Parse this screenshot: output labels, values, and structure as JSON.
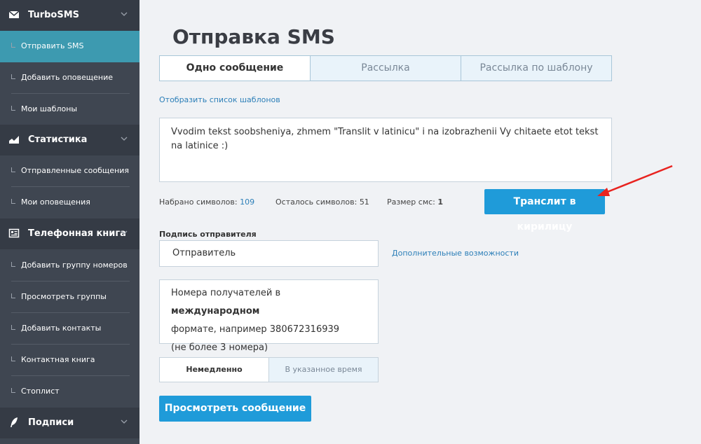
{
  "sidebar": {
    "sections": [
      {
        "title": "TurboSMS",
        "icon": "envelope-icon"
      },
      {
        "title": "Статистика",
        "icon": "chart-icon"
      },
      {
        "title": "Телефонная книга",
        "icon": "phonebook-icon"
      },
      {
        "title": "Подписи",
        "icon": "feather-icon"
      }
    ],
    "items": [
      {
        "label": "Отправить SMS",
        "active": true
      },
      {
        "label": "Добавить оповещение"
      },
      {
        "label": "Мои шаблоны"
      },
      {
        "label": "Отправленные сообщения"
      },
      {
        "label": "Мои оповещения"
      },
      {
        "label": "Добавить группу номеров"
      },
      {
        "label": "Просмотреть группы"
      },
      {
        "label": "Добавить контакты"
      },
      {
        "label": "Контактная книга"
      },
      {
        "label": "Стоплист"
      }
    ]
  },
  "main": {
    "title": "Отправка SMS",
    "tabs": [
      {
        "label": "Одно сообщение",
        "active": true
      },
      {
        "label": "Рассылка"
      },
      {
        "label": "Рассылка по шаблону"
      }
    ],
    "show_templates_link": "Отобразить список шаблонов",
    "message_text": "Vvodim tekst soobsheniya, zhmem \"Translit v latinicu\" i na izobrazhenii Vy chitaete etot tekst na latinice :)",
    "stats": {
      "typed_label": "Набрано символов:",
      "typed_value": "109",
      "remaining_label": "Осталось символов:",
      "remaining_value": "51",
      "size_label": "Размер смс:",
      "size_value": "1"
    },
    "translit_button": "Транслит в кирилицу",
    "sender_label": "Подпись отправителя",
    "sender_value": "Отправитель",
    "extra_options_link": "Дополнительные возможности",
    "recipients": {
      "text_before": "Номера получателей в ",
      "text_bold": "международном",
      "text_line2": "формате, например 380672316939",
      "text_line3": "(не более 3 номера)"
    },
    "timing": {
      "immediate": "Немедленно",
      "scheduled": "В указанное время"
    },
    "preview_button": "Просмотреть сообщение"
  },
  "colors": {
    "sidebar_bg": "#3f4651",
    "sidebar_header_bg": "#353b45",
    "active_item_bg": "#3d9ab0",
    "primary_button": "#1f9bd9",
    "link": "#2c7fb8",
    "arrow": "#e8231f"
  }
}
